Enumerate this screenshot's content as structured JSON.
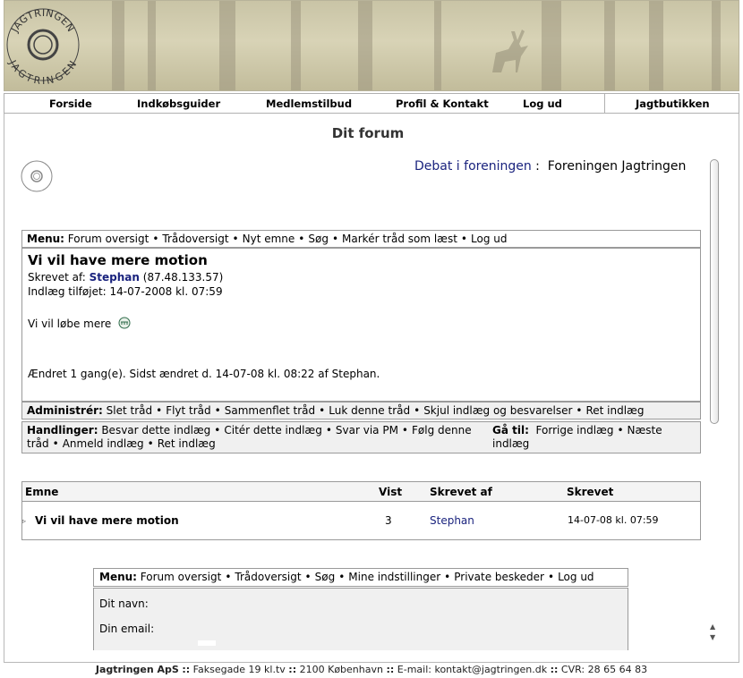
{
  "banner": {
    "logo_text_top": "JAGTRINGEN",
    "logo_text_bottom": "JAGTRINGEN"
  },
  "nav": {
    "items": [
      "Forside",
      "Indkøbsguider",
      "Medlemstilbud",
      "Profil & Kontakt",
      "Log ud",
      "Jagtbutikken"
    ]
  },
  "page_title": "Dit forum",
  "forum_head": {
    "link": "Debat i foreningen",
    "sep": ":",
    "name": "Foreningen Jagtringen"
  },
  "top_menu": {
    "label": "Menu:",
    "items": [
      "Forum oversigt",
      "Trådoversigt",
      "Nyt emne",
      "Søg",
      "Markér tråd som læst",
      "Log ud"
    ]
  },
  "post": {
    "title": "Vi vil have mere motion",
    "written_by_label": "Skrevet af:",
    "author": "Stephan",
    "ip": "(87.48.133.57)",
    "added": "Indlæg tilføjet: 14-07-2008 kl. 07:59",
    "body": "Vi vil løbe mere",
    "edited": "Ændret 1 gang(e). Sidst ændret d. 14-07-08 kl. 08:22 af Stephan."
  },
  "admin": {
    "label": "Administrér:",
    "items": [
      "Slet tråd",
      "Flyt tråd",
      "Sammenflet tråd",
      "Luk denne tråd",
      "Skjul indlæg og besvarelser",
      "Ret indlæg"
    ]
  },
  "actions": {
    "label": "Handlinger:",
    "items_line1": [
      "Besvar dette indlæg",
      "Citér dette indlæg",
      "Svar via PM",
      "Følg denne"
    ],
    "items_line2_start": "tråd",
    "items_line2": [
      "Anmeld indlæg",
      "Ret indlæg"
    ],
    "goto_label": "Gå til:",
    "goto_items": [
      "Forrige indlæg",
      "Næste indlæg"
    ]
  },
  "topics": {
    "headers": [
      "Emne",
      "Vist",
      "Skrevet af",
      "Skrevet"
    ],
    "rows": [
      {
        "subject": "Vi vil have mere motion",
        "views": "3",
        "author": "Stephan",
        "date": "14-07-08 kl. 07:59"
      }
    ]
  },
  "bottom_menu": {
    "label": "Menu:",
    "items": [
      "Forum oversigt",
      "Trådoversigt",
      "Søg",
      "Mine indstillinger",
      "Private beskeder",
      "Log ud"
    ]
  },
  "form": {
    "name_label": "Dit navn:",
    "email_label": "Din email:"
  },
  "footer": {
    "company": "Jagtringen ApS",
    "sep": "::",
    "address": "Faksegade 19 kl.tv",
    "city": "2100 København",
    "email": "E-mail: kontakt@jagtringen.dk",
    "cvr": "CVR: 28 65 64 83"
  },
  "colors": {
    "link": "#1a237e",
    "banner": "#cfcaac"
  }
}
